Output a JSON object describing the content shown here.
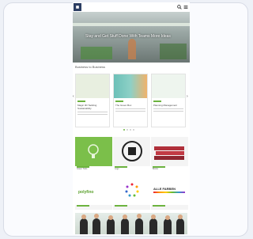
{
  "hero": {
    "title": "Stay and Get Stuff Done With Teams More Ideas"
  },
  "section": {
    "title": "Business to Business"
  },
  "slides": [
    {
      "title": "Magic 3D Tackling Sustainability",
      "img_color": "#e8efe0"
    },
    {
      "title": "The Green Box",
      "img_color": "#6cc0b8"
    },
    {
      "title": "Planning Management",
      "img_color": "#eef5ee"
    }
  ],
  "tiles": [
    {
      "caption": "Green Tools",
      "bg": "#7bbf4a"
    },
    {
      "caption": "Logo",
      "bg": "#f4f4f4"
    },
    {
      "caption": "Books",
      "bg": "#f4f4f4"
    },
    {
      "caption": "",
      "bg": "#ffffff"
    },
    {
      "caption": "",
      "bg": "#ffffff"
    },
    {
      "caption": "",
      "bg": "#ffffff"
    }
  ],
  "tile_text": {
    "logo2": "polyfino",
    "logo3": "ALLE FARBEN"
  },
  "colors": {
    "accent": "#6cb33f",
    "brand": "#2c3e63"
  },
  "icons": [
    "logo-icon",
    "search-icon",
    "menu-icon",
    "arrow-left-icon",
    "arrow-right-icon"
  ]
}
